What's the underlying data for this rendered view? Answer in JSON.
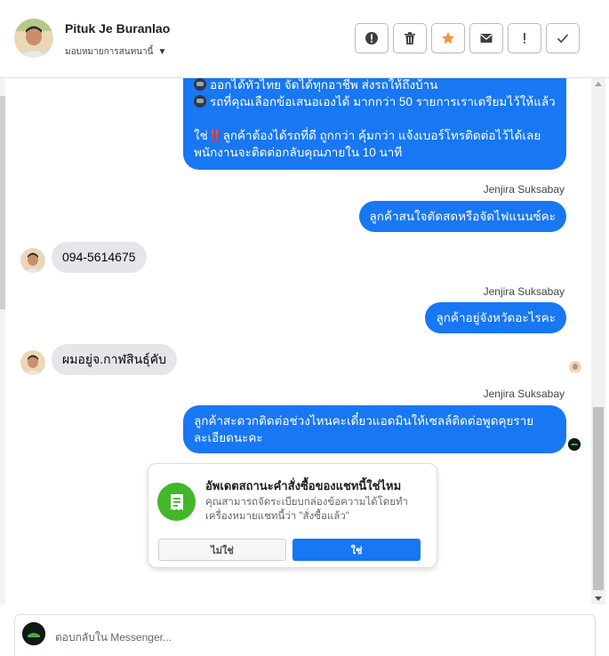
{
  "header": {
    "name": "Pituk Je Buranlao",
    "assign_label": "มอบหมายการสนทนานี้",
    "actions": [
      {
        "icon": "report-icon"
      },
      {
        "icon": "trash-icon"
      },
      {
        "icon": "star-icon",
        "color": "#f7923b"
      },
      {
        "icon": "envelope-icon"
      },
      {
        "icon": "exclamation-icon"
      },
      {
        "icon": "check-icon"
      }
    ]
  },
  "messages": {
    "m1": {
      "line1": "ออกได้ทั่วไทย จัดได้ทุกอาชีพ ส่งรถให้ถึงบ้าน",
      "line2": "รถที่คุณเลือกข้อเสนอเองได้ มากกว่า 50 รายการเราเตรียมไว้ให้แล้ว",
      "line3_pre": "ใช่",
      "line3_mark": "‼️",
      "line3_post": "ลูกค้าต้องได้รถที่ดี ถูกกว่า คุ้มกว่า แจ้งเบอร์โทรติดต่อไว้ได้เลย",
      "line4": "พนักงานจะติดต่อกลับคุณภายใน 10 นาที"
    },
    "sender": "Jenjira Suksabay",
    "m2": "ลูกค้าสนใจตัดสดหรือจัดไฟแนนซ์คะ",
    "m3": "094-5614675",
    "m4": "ลูกค้าอยู่จังหวัดอะไรคะ",
    "m5": "ผมอยู่จ.กาฬสินธุ์คับ",
    "m6": "ลูกค้าสะดวกติดต่อช่วงไหนคะเดี๋ยวแอดมินให้เซลล์ติดต่อพูดคุยรายละเอียดนะคะ"
  },
  "card": {
    "title": "อัพเดตสถานะคำสั่งซื้อของแชทนี้ใช่ไหม",
    "desc": "คุณสามารถจัดระเบียบกล่องข้อความได้โดยทำเครื่องหมายแชทนี้ว่า \"สั่งซื้อแล้ว\"",
    "no_label": "ไม่ใช่",
    "yes_label": "ใช่"
  },
  "composer": {
    "placeholder": "ตอบกลับใน Messenger..."
  },
  "colors": {
    "accent": "#1877f2",
    "incoming_bubble": "#e4e6eb",
    "success": "#42b72a"
  }
}
